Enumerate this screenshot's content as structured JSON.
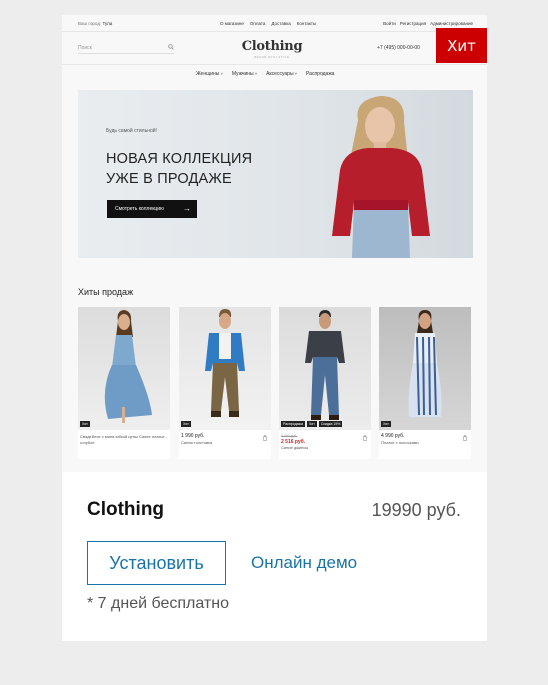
{
  "badge": "Хит",
  "site": {
    "topbar": {
      "city_label": "Ваш город:",
      "city": "Тула",
      "links": [
        "О магазине",
        "Оплата",
        "Доставка",
        "Контакты"
      ],
      "account": [
        "Войти",
        "Регистрация",
        "Администрирование"
      ]
    },
    "search_placeholder": "Поиск",
    "logo": "Clothing",
    "logo_sub": "BRAND WITH STYLE",
    "phone": "+7 (495) 000-00-00",
    "nav": [
      "Женщины",
      "Мужчины",
      "Аксессуары",
      "Распродажа"
    ],
    "hero": {
      "tag": "Будь самой стильной!",
      "title_line1": "НОВАЯ КОЛЛЕКЦИЯ",
      "title_line2": "УЖЕ В ПРОДАЖЕ",
      "button": "Смотреть коллекцию",
      "button_arrow": "→"
    },
    "section_title": "Хиты продаж",
    "products": [
      {
        "badges": [
          "Хит"
        ],
        "price": "",
        "old_price": "",
        "sale_price": "",
        "name": "Свадебное с мини-юбкой цены Синее платье - голубое"
      },
      {
        "badges": [
          "Хит"
        ],
        "price": "1 990 руб.",
        "old_price": "",
        "sale_price": "",
        "name": "Синяя толстовка"
      },
      {
        "badges": [
          "Распродажа",
          "Хит",
          "Скидка 15%"
        ],
        "price": "",
        "old_price": "3 490 руб.",
        "sale_price": "2 516 руб.",
        "name": "Синие джинсы"
      },
      {
        "badges": [
          "Хит"
        ],
        "price": "4 990 руб.",
        "old_price": "",
        "sale_price": "",
        "name": "Платье с полосками"
      }
    ]
  },
  "product": {
    "name": "Clothing",
    "price": "19990 руб.",
    "install_button": "Установить",
    "demo_link": "Онлайн демо",
    "trial_note": "* 7 дней бесплатно"
  },
  "colors": {
    "accent": "#1a73a8",
    "badge_red": "#cc0000",
    "sweater_red": "#b51e2a"
  }
}
